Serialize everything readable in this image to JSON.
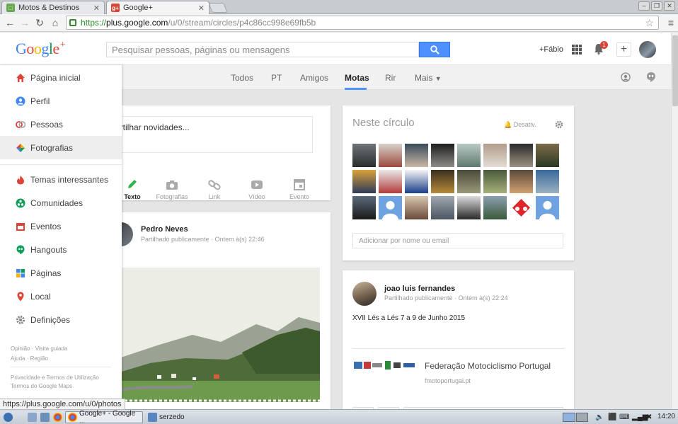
{
  "browser": {
    "tabs": [
      {
        "label": "Motos & Destinos",
        "active": false
      },
      {
        "label": "Google+",
        "active": true
      }
    ],
    "url": {
      "scheme": "https://",
      "host": "plus.google.com",
      "path": "/u/0/stream/circles/p4c86cc998e69fb5b"
    },
    "status_url": "https://plus.google.com/u/0/photos"
  },
  "header": {
    "logo_text": "Google",
    "logo_plus": "+",
    "search_placeholder": "Pesquisar pessoas, páginas ou mensagens",
    "user_link": "+Fábio",
    "notification_count": "1",
    "share_symbol": "+"
  },
  "stream_nav": {
    "items": [
      "Todos",
      "PT",
      "Amigos",
      "Motas",
      "Rir",
      "Mais"
    ],
    "active": "Motas"
  },
  "sidemenu": {
    "items": [
      {
        "label": "Página inicial",
        "icon": "home-icon"
      },
      {
        "label": "Perfil",
        "icon": "profile-icon"
      },
      {
        "label": "Pessoas",
        "icon": "people-icon"
      },
      {
        "label": "Fotografias",
        "icon": "photos-icon"
      },
      {
        "label": "Temas interessantes",
        "icon": "trending-icon"
      },
      {
        "label": "Comunidades",
        "icon": "communities-icon"
      },
      {
        "label": "Eventos",
        "icon": "events-icon"
      },
      {
        "label": "Hangouts",
        "icon": "hangouts-icon"
      },
      {
        "label": "Páginas",
        "icon": "pages-icon"
      },
      {
        "label": "Local",
        "icon": "local-icon"
      },
      {
        "label": "Definições",
        "icon": "settings-icon"
      }
    ],
    "footer": {
      "line1": [
        "Opinião",
        "Visita guiada"
      ],
      "line2": [
        "Ajuda",
        "Região"
      ],
      "line3": "Privacidade e Termos de Utilização",
      "line4": "Termos do Google Maps"
    }
  },
  "share_box": {
    "prompt": "artilhar novidades...",
    "tools": [
      "Texto",
      "Fotografias",
      "Link",
      "Vídeo",
      "Evento"
    ]
  },
  "post1": {
    "author": "Pedro Neves",
    "visibility": "Partilhado publicamente",
    "time": "Ontem à(s) 22:46"
  },
  "circle": {
    "title": "Neste círculo",
    "notify_label": "Desativ.",
    "add_placeholder": "Adicionar por nome ou email"
  },
  "post2": {
    "author": "joao luis fernandes",
    "visibility": "Partilhado publicamente",
    "time": "Ontem à(s) 22:24",
    "text": "XVII Lés a Lés 7 a 9 de Junho 2015",
    "link_title": "Federação Motociclismo Portugal",
    "link_host": "fmotoportugal.pt"
  },
  "taskbar": {
    "items": [
      "Google+ - Google ...",
      "serzedo"
    ],
    "clock": "14:20"
  }
}
